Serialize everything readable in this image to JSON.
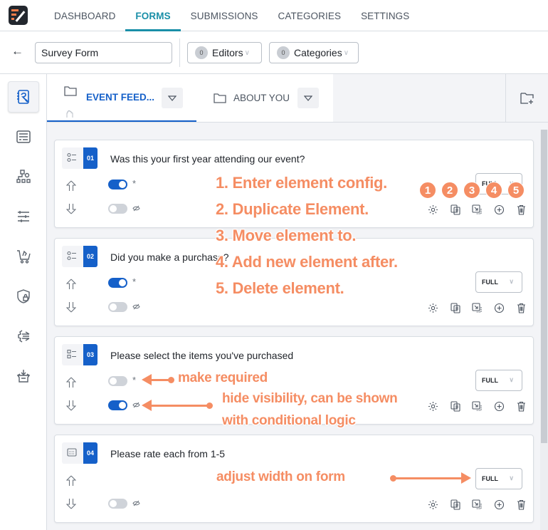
{
  "nav": {
    "items": [
      {
        "label": "DASHBOARD",
        "active": false
      },
      {
        "label": "FORMS",
        "active": true
      },
      {
        "label": "SUBMISSIONS",
        "active": false
      },
      {
        "label": "CATEGORIES",
        "active": false
      },
      {
        "label": "SETTINGS",
        "active": false
      }
    ]
  },
  "toolbar": {
    "form_title": "Survey Form",
    "editors": {
      "count": "0",
      "label": "Editors"
    },
    "categories": {
      "count": "0",
      "label": "Categories"
    }
  },
  "sidebar": {
    "icons": [
      "form-editor-icon",
      "layout-icon",
      "workflow-settings-icon",
      "sliders-icon",
      "cart-icon",
      "shield-lock-icon",
      "integrations-icon",
      "box-import-icon"
    ]
  },
  "tabs": [
    {
      "label": "EVENT FEED...",
      "active": true
    },
    {
      "label": "ABOUT YOU",
      "active": false
    }
  ],
  "elements": [
    {
      "num": "01",
      "question": "Was this your first year attending our event?",
      "type": "choice",
      "required": true,
      "hidden": false,
      "width": "FULL",
      "has_required_toggle": true
    },
    {
      "num": "02",
      "question": "Did you make a purchase?",
      "type": "choice",
      "required": true,
      "hidden": false,
      "width": "FULL",
      "has_required_toggle": true
    },
    {
      "num": "03",
      "question": "Please select the items you've purchased",
      "type": "checklist",
      "required": false,
      "hidden": true,
      "width": "FULL",
      "has_required_toggle": true
    },
    {
      "num": "04",
      "question": "Please rate each from 1-5",
      "type": "matrix",
      "required": false,
      "hidden": false,
      "width": "FULL",
      "has_required_toggle": false
    }
  ],
  "symbols": {
    "required": "*"
  },
  "annotations": {
    "actions_list": [
      "1. Enter element config.",
      "2. Duplicate Element.",
      "3. Move element to.",
      "4. Add new element after.",
      "5. Delete element."
    ],
    "badges": [
      "1",
      "2",
      "3",
      "4",
      "5"
    ],
    "make_required": "make required",
    "hide_visibility_1": "hide visibility, can be shown",
    "hide_visibility_2": "with conditional logic",
    "adjust_width": "adjust width on form"
  },
  "colors": {
    "accent": "#1560c9",
    "nav_active": "#1a8fa8",
    "annotation": "#f58d63"
  }
}
